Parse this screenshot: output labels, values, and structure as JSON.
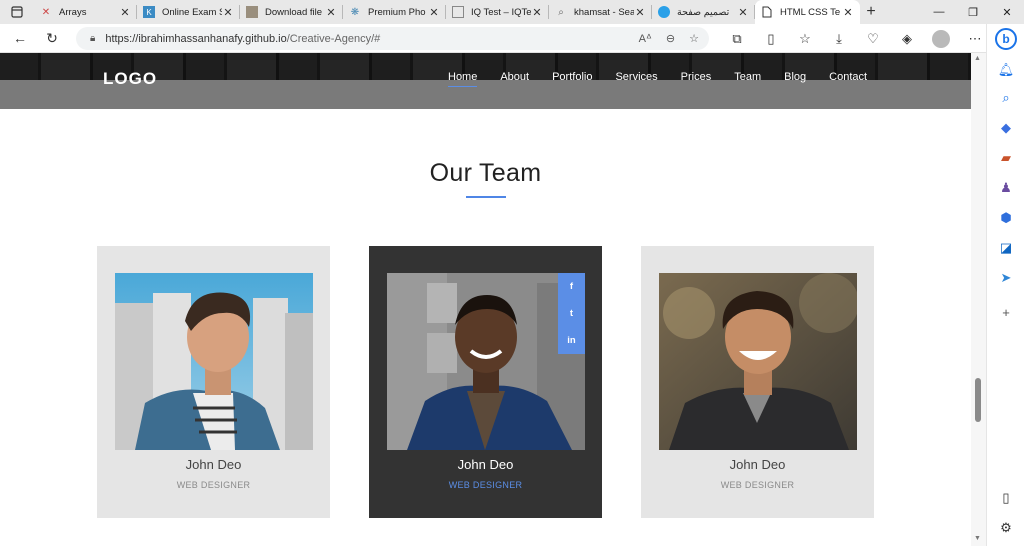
{
  "browser": {
    "tabs": [
      {
        "title": "Arrays",
        "icon": "arrays-favicon",
        "active": false
      },
      {
        "title": "Online Exam S",
        "icon": "exam-favicon",
        "active": false
      },
      {
        "title": "Download file",
        "icon": "download-favicon",
        "active": false
      },
      {
        "title": "Premium Pho",
        "icon": "photo-favicon",
        "active": false
      },
      {
        "title": "IQ Test – IQTe",
        "icon": "iqtest-favicon",
        "active": false
      },
      {
        "title": "khamsat - Sea",
        "icon": "search-favicon",
        "active": false
      },
      {
        "title": "تصميم صفحة",
        "icon": "design-favicon",
        "active": false
      },
      {
        "title": "HTML CSS Te",
        "icon": "page-favicon",
        "active": true
      }
    ],
    "url_host": "https://ibrahimhassanhanafy.github.io",
    "url_path": "/Creative-Agency/#"
  },
  "site": {
    "logo": "LOGO",
    "menu": [
      "Home",
      "About",
      "Portfolio",
      "Services",
      "Prices",
      "Team",
      "Blog",
      "Contact"
    ],
    "active_menu": "Home",
    "section_title": "Our Team",
    "members": [
      {
        "name": "John Deo",
        "role": "WEB DESIGNER"
      },
      {
        "name": "John Deo",
        "role": "WEB DESIGNER"
      },
      {
        "name": "John Deo",
        "role": "WEB DESIGNER"
      }
    ],
    "social": [
      "f",
      "t",
      "in"
    ]
  },
  "colors": {
    "accent": "#5b8ee6",
    "card_light": "#e5e5e5",
    "card_dark": "#333333",
    "navbar_gray": "#7a7a7a"
  }
}
